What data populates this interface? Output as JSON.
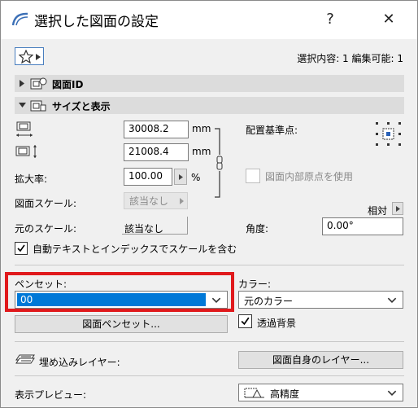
{
  "window": {
    "title": "選択した図面の設定",
    "help_label": "?",
    "close_label": "✕"
  },
  "toolbar": {
    "selection_info": "選択内容: 1 編集可能: 1"
  },
  "sections": {
    "drawing_id": "図面ID",
    "size_display": "サイズと表示"
  },
  "size": {
    "width_value": "30008.2",
    "height_value": "21008.4",
    "unit": "mm",
    "scale_label": "拡大率:",
    "scale_value": "100.00",
    "scale_unit": "%",
    "drawing_scale_label": "図面スケール:",
    "drawing_scale_value": "該当なし",
    "original_scale_label": "元のスケール:",
    "original_scale_value": "該当なし"
  },
  "anchor": {
    "label": "配置基準点:",
    "use_internal_origin": "図面内部原点を使用",
    "relative_label": "相対",
    "angle_label": "角度:",
    "angle_value": "0.00°"
  },
  "auto_text": {
    "label": "自動テキストとインデックスでスケールを含む",
    "checked": true
  },
  "pen": {
    "label": "ペンセット:",
    "value": "00",
    "button": "図面ペンセット..."
  },
  "color": {
    "label": "カラー:",
    "value": "元のカラー",
    "transparent_label": "透過背景",
    "transparent_checked": true
  },
  "layers": {
    "label": "埋め込みレイヤー:",
    "button": "図面自身のレイヤー..."
  },
  "preview": {
    "label": "表示プレビュー:",
    "value": "高精度"
  },
  "colors": {
    "highlight": "#e0191c",
    "selection": "#0078d7",
    "section_bar": "#dcdcdc"
  }
}
